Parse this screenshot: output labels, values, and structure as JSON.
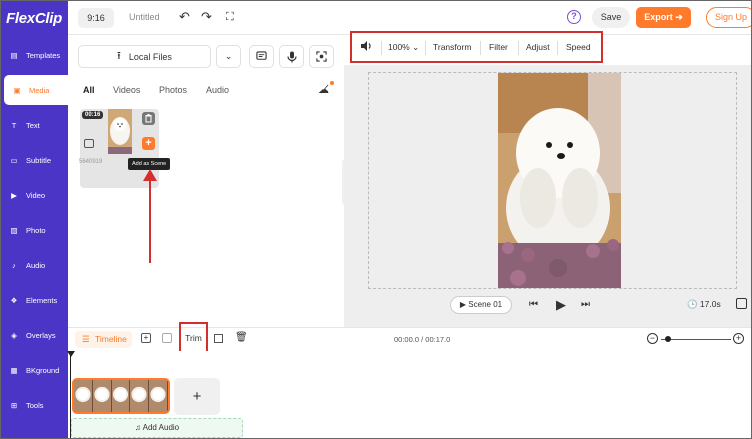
{
  "app": {
    "logo": "FlexClip",
    "ratio": "9:16",
    "project_title": "Untitled"
  },
  "header": {
    "save": "Save",
    "export": "Export",
    "signup": "Sign Up",
    "help": "?"
  },
  "sidebar": {
    "items": [
      {
        "label": "Templates",
        "icon": "templates-icon"
      },
      {
        "label": "Media",
        "icon": "media-icon"
      },
      {
        "label": "Text",
        "icon": "text-icon"
      },
      {
        "label": "Subtitle",
        "icon": "subtitle-icon"
      },
      {
        "label": "Video",
        "icon": "video-icon"
      },
      {
        "label": "Photo",
        "icon": "photo-icon"
      },
      {
        "label": "Audio",
        "icon": "audio-icon"
      },
      {
        "label": "Elements",
        "icon": "elements-icon"
      },
      {
        "label": "Overlays",
        "icon": "overlays-icon"
      },
      {
        "label": "BKground",
        "icon": "background-icon"
      },
      {
        "label": "Tools",
        "icon": "tools-icon"
      }
    ],
    "active": "Media"
  },
  "media_panel": {
    "local_files": "Local Files",
    "ai_badge": "AI",
    "tabs": [
      "All",
      "Videos",
      "Photos",
      "Audio"
    ],
    "active_tab": "All",
    "asset": {
      "duration": "00:16",
      "id": "5640919",
      "tooltip": "Add as Scene"
    }
  },
  "preview_toolbar": {
    "zoom": "100%",
    "buttons": [
      "Transform",
      "Filter",
      "Adjust",
      "Speed"
    ]
  },
  "player": {
    "scene": "Scene 01",
    "duration": "17.0s"
  },
  "timeline": {
    "label": "Timeline",
    "trim": "Trim",
    "time": "00:00.0 / 00:17.0",
    "add_audio": "Add Audio"
  },
  "colors": {
    "brand": "#4a35c7",
    "accent": "#ff7a2b",
    "highlight_box": "#d32f2f"
  }
}
